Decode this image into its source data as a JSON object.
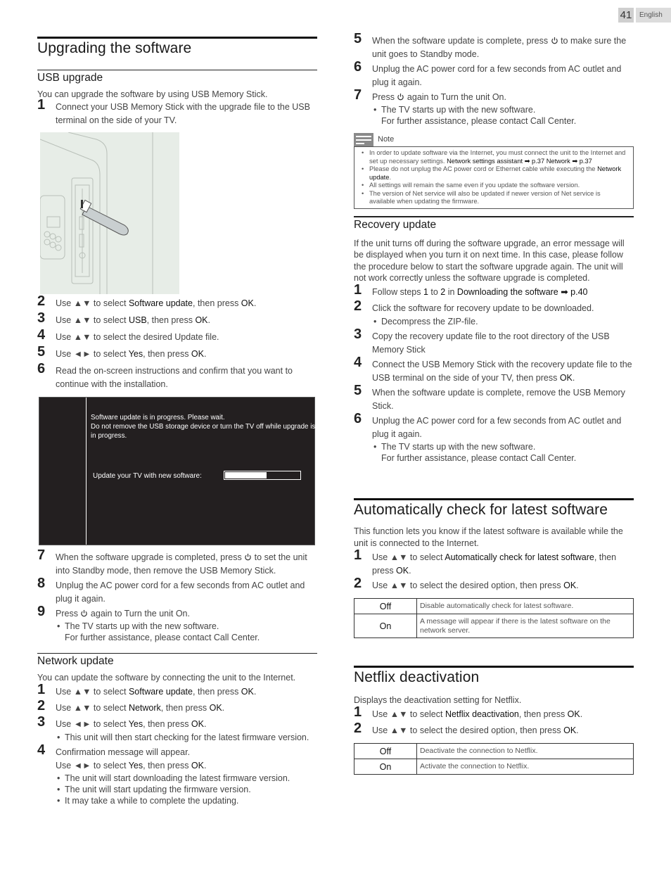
{
  "header": {
    "page_number": "41",
    "language": "English"
  },
  "left": {
    "title": "Upgrading the software",
    "usb": {
      "heading": "USB upgrade",
      "intro": "You can upgrade the software by using USB Memory Stick.",
      "steps": [
        {
          "n": "1",
          "text": "Connect your USB Memory Stick with the upgrade file to the USB terminal on the side of your TV."
        },
        {
          "n": "2",
          "pre": "Use ▲▼ to select ",
          "bold": "Software update",
          "mid": ", then press ",
          "bold2": "OK",
          "post": "."
        },
        {
          "n": "3",
          "pre": "Use ▲▼ to select ",
          "bold": "USB",
          "mid": ", then press ",
          "bold2": "OK",
          "post": "."
        },
        {
          "n": "4",
          "text": "Use ▲▼ to select the desired Update file."
        },
        {
          "n": "5",
          "pre": "Use ◄► to select ",
          "bold": "Yes",
          "mid": ", then press ",
          "bold2": "OK",
          "post": "."
        },
        {
          "n": "6",
          "text": "Read the on-screen instructions and confirm that you want to continue with the installation."
        },
        {
          "n": "7",
          "pre": "When the software upgrade is completed, press ",
          "post": " to set the unit into Standby mode, then remove the USB Memory Stick."
        },
        {
          "n": "8",
          "text": "Unplug the AC power cord for a few seconds from AC outlet and plug it again."
        },
        {
          "n": "9",
          "pre": "Press ",
          "post": " again to Turn the unit On.",
          "bullet": "The TV starts up with the new software.",
          "bullet2": "For further assistance, please contact Call Center."
        }
      ],
      "screen": {
        "line1": "Software update is in progress. Please wait.",
        "line2": "Do not remove the USB storage device or turn the TV off while upgrade is in progress.",
        "progress_label": "Update your TV with new software:",
        "progress_fraction": 0.55
      }
    },
    "network": {
      "heading": "Network update",
      "intro": "You can update the software by connecting the unit to the Internet.",
      "s1": {
        "n": "1",
        "pre": "Use ▲▼ to select ",
        "bold": "Software update",
        "mid": ", then press ",
        "bold2": "OK",
        "post": "."
      },
      "s2": {
        "n": "2",
        "pre": "Use ▲▼ to select ",
        "bold": "Network",
        "mid": ", then press ",
        "bold2": "OK",
        "post": "."
      },
      "s3": {
        "n": "3",
        "pre": "Use ◄► to select ",
        "bold": "Yes",
        "mid": ", then press ",
        "bold2": "OK",
        "post": ".",
        "bullet": "This unit will then start checking for the latest firmware version."
      },
      "s4": {
        "n": "4",
        "text": "Confirmation message will appear.",
        "pre": "Use ◄► to select ",
        "bold": "Yes",
        "mid": ", then press ",
        "bold2": "OK",
        "post": ".",
        "bullets": [
          "The unit will start downloading the latest firmware version.",
          "The unit will start updating the firmware version.",
          "It may take a while to complete the updating."
        ]
      }
    }
  },
  "right": {
    "cont": {
      "s5": {
        "n": "5",
        "pre": "When the software update is complete, press ",
        "post": " to make sure the unit goes to Standby mode."
      },
      "s6": {
        "n": "6",
        "text": "Unplug the AC power cord for a few seconds from AC outlet and plug it again."
      },
      "s7": {
        "n": "7",
        "pre": "Press ",
        "post": " again to Turn the unit On.",
        "bullet": "The TV starts up with the new software.",
        "bullet2": "For further assistance, please contact Call Center."
      }
    },
    "note": {
      "label": "Note",
      "items": [
        {
          "pre": "In order to update software via the Internet, you must connect the unit to the Internet and set up necessary settings. ",
          "bold": "Network settings assistant ➡ p.37 Network ➡ p.37"
        },
        {
          "pre": "Please do not unplug the AC power cord or Ethernet cable while executing the ",
          "bold": "Network update",
          "post": "."
        },
        {
          "pre": "All settings will remain the same even if you update the software version."
        },
        {
          "pre": "The version of Net service will also be updated if newer version of Net service is available when updating the firmware."
        }
      ]
    },
    "recovery": {
      "heading": "Recovery update",
      "intro": "If the unit turns off during the software upgrade, an error message will be displayed when you turn it on next time. In this case, please follow the procedure below to start the software upgrade again. The unit will not work correctly unless the software upgrade is completed.",
      "s1": {
        "n": "1",
        "pre": "Follow steps ",
        "b1": "1",
        "mid": " to ",
        "b2": "2",
        "mid2": " in ",
        "b3": "Downloading the software ➡ p.40"
      },
      "s2": {
        "n": "2",
        "text": "Click the software for recovery update to be downloaded.",
        "bullet": "Decompress the ZIP-file."
      },
      "s3": {
        "n": "3",
        "text": "Copy the  recovery update file to the root directory of the USB Memory Stick"
      },
      "s4": {
        "n": "4",
        "pre": "Connect the USB Memory Stick with the  recovery update file to the USB terminal on the side of your TV, then press ",
        "bold": "OK",
        "post": "."
      },
      "s5": {
        "n": "5",
        "text": "When the software update is complete, remove the USB Memory Stick."
      },
      "s6": {
        "n": "6",
        "text": "Unplug the AC power cord for a few seconds from AC outlet and plug it again.",
        "bullet": "The TV starts up with the new software.",
        "bullet2": "For further assistance, please contact Call Center."
      }
    },
    "autocheck": {
      "title": "Automatically check for latest software",
      "intro": "This function lets you know if the latest software is available while the unit is connected to the Internet.",
      "s1": {
        "n": "1",
        "pre": "Use ▲▼ to select ",
        "bold": "Automatically check for latest software",
        "mid": ", then press ",
        "bold2": "OK",
        "post": "."
      },
      "s2": {
        "n": "2",
        "pre": "Use ▲▼ to select the desired option, then press ",
        "bold2": "OK",
        "post": "."
      },
      "options": [
        {
          "key": "Off",
          "desc": "Disable automatically check for latest software."
        },
        {
          "key": "On",
          "desc": "A message will appear if there is the latest software on the network server."
        }
      ]
    },
    "netflix": {
      "title": "Netflix deactivation",
      "intro": "Displays the deactivation setting for Netflix.",
      "s1": {
        "n": "1",
        "pre": "Use ▲▼ to select ",
        "bold": "Netflix deactivation",
        "mid": ", then press ",
        "bold2": "OK",
        "post": "."
      },
      "s2": {
        "n": "2",
        "pre": "Use ▲▼ to select the desired option, then press ",
        "bold2": "OK",
        "post": "."
      },
      "options": [
        {
          "key": "Off",
          "desc": "Deactivate the connection to Netflix."
        },
        {
          "key": "On",
          "desc": "Activate the connection to Netflix."
        }
      ]
    }
  }
}
